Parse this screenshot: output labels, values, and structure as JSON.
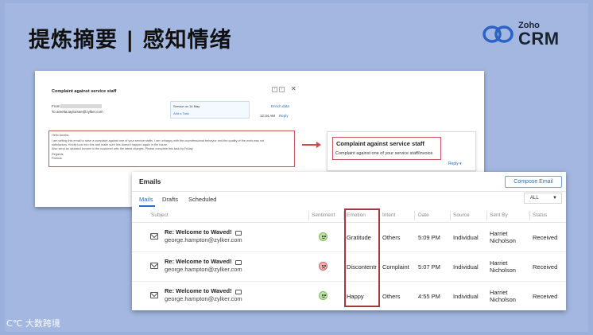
{
  "slide": {
    "title": "提炼摘要 | 感知情绪",
    "brand_top": "Zoho",
    "brand_main": "CRM",
    "watermark": "大数跨境",
    "watermark_mark": "ᑕ℃"
  },
  "email_preview": {
    "title": "Complaint against service staff",
    "from_label": "From",
    "to_line": "To amelia.taylorsee@zylker.com",
    "service_line": "Service on 14 May",
    "add_task": "Add a Task",
    "enrich": "Enrich data",
    "time": "12:34 AM",
    "reply": "Reply",
    "body": [
      "Hello Amelia,",
      "I am writing this email to raise a complaint against one of your service staffs. I am unhappy with the unprofessional behavior and the quality of the work was not",
      "satisfactory. Kindly look into this and make sure this doesn't happen again in the future.",
      "Also send an updated invoice to the customer with the latest charges. Please complete this task by Friday.",
      "Regards,",
      "Patricia"
    ]
  },
  "summary": {
    "title": "Complaint against service staff",
    "body": "Complaint against one of your service staff/invoice",
    "reply": "Reply"
  },
  "emails": {
    "title": "Emails",
    "compose_label": "Compose Email",
    "tabs": [
      "Mails",
      "Drafts",
      "Scheduled"
    ],
    "filter": "ALL",
    "columns": [
      "Subject",
      "Sentiment",
      "Emotion",
      "Intent",
      "Date",
      "Source",
      "Sent By",
      "Status"
    ],
    "rows": [
      {
        "subject": "Re: Welcome to Waved!",
        "address": "george.hampton@zylker.com",
        "sentiment": "positive",
        "emotion": "Gratitude",
        "intent": "Others",
        "date": "5:09 PM",
        "source": "Individual",
        "sent_by_1": "Harriet",
        "sent_by_2": "Nicholson",
        "status": "Received"
      },
      {
        "subject": "Re: Welcome to Waved!",
        "address": "george.hampton@zylker.com",
        "sentiment": "negative",
        "emotion": "Discontentr",
        "intent": "Complaint",
        "date": "5:07 PM",
        "source": "Individual",
        "sent_by_1": "Harriet",
        "sent_by_2": "Nicholson",
        "status": "Received"
      },
      {
        "subject": "Re: Welcome to Waved!",
        "address": "george.hampton@zylker.com",
        "sentiment": "positive",
        "emotion": "Happy",
        "intent": "Others",
        "date": "4:55 PM",
        "source": "Individual",
        "sent_by_1": "Harriet",
        "sent_by_2": "Nicholson",
        "status": "Received"
      }
    ]
  },
  "colors": {
    "slide_bg": "#a3b7e0",
    "accent_blue": "#2b6cc4",
    "highlight_red": "#a23b3b"
  }
}
